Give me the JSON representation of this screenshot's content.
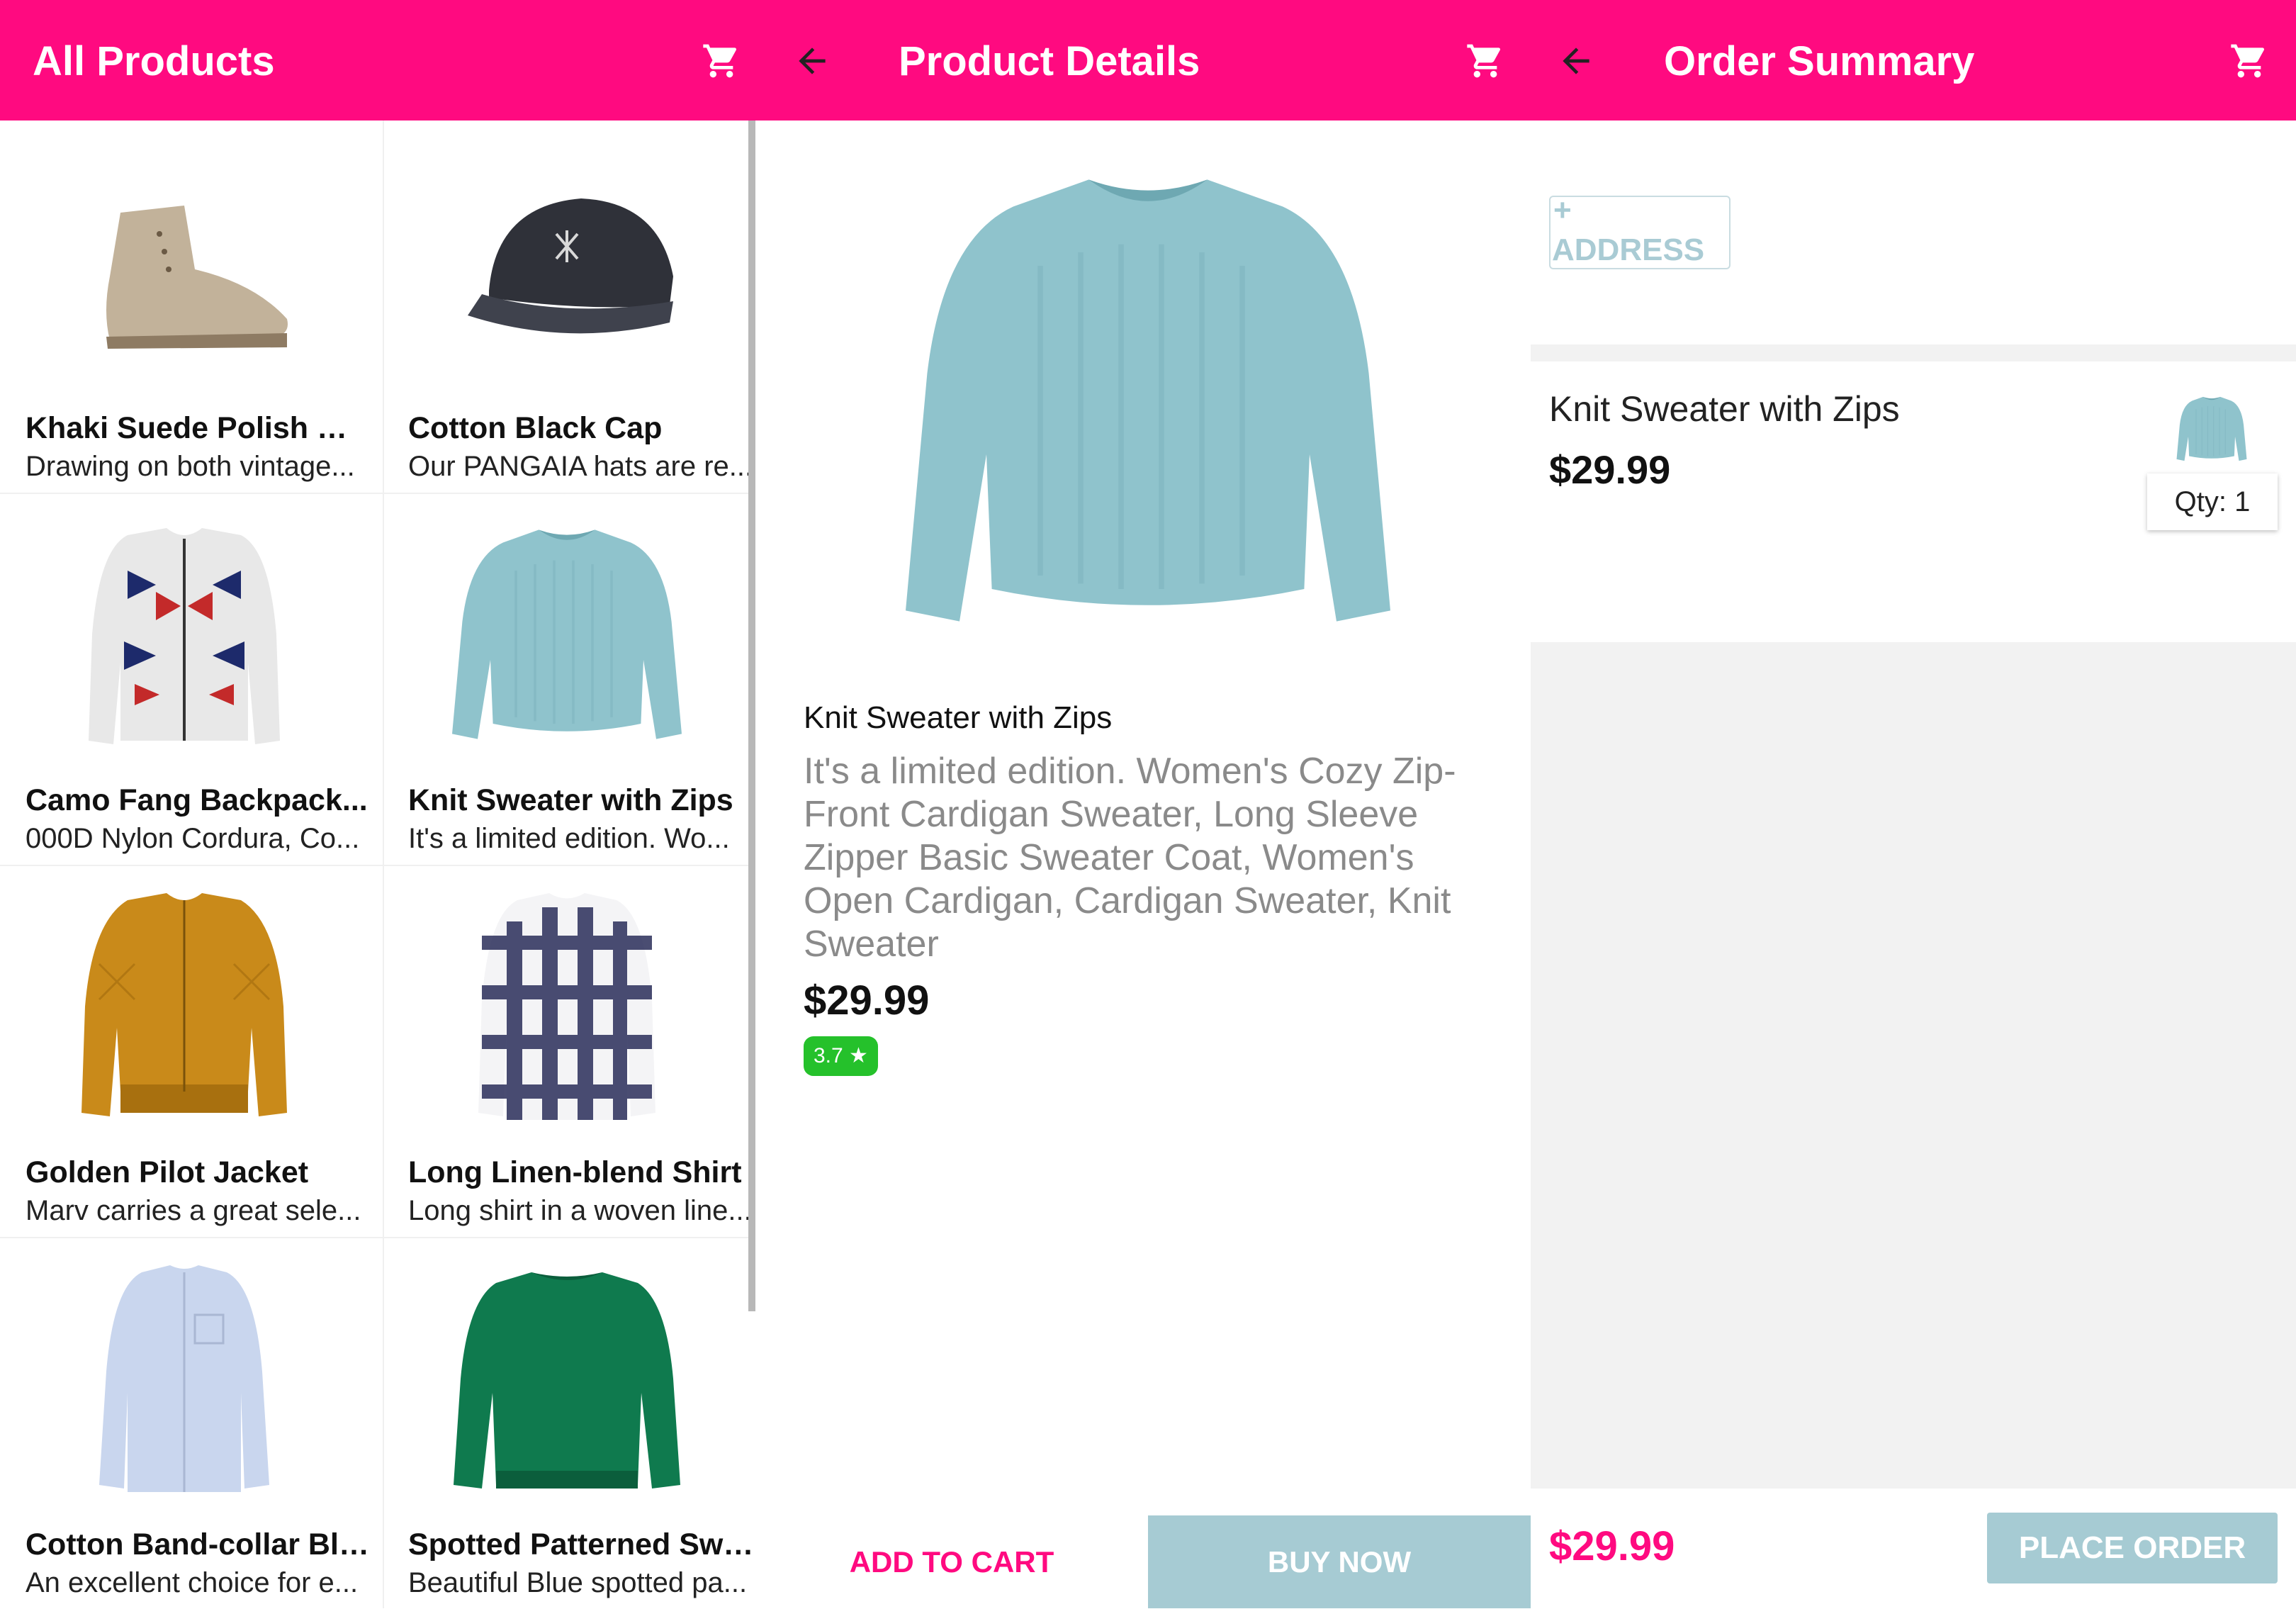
{
  "theme": {
    "primary": "#ff0a80",
    "muted_button": "#a6cbd3",
    "rating_green": "#25c12b"
  },
  "products_screen": {
    "title": "All Products",
    "cart_icon": "cart-icon",
    "products": [
      {
        "name": "Khaki Suede Polish Wo...",
        "description": "Drawing on both vintage..."
      },
      {
        "name": "Cotton Black Cap",
        "description": "Our PANGAIA hats are re..."
      },
      {
        "name": "Camo Fang Backpack...",
        "description": "000D Nylon Cordura, Co..."
      },
      {
        "name": "Knit Sweater with Zips",
        "description": "It's a limited edition. Wo..."
      },
      {
        "name": "Golden Pilot Jacket",
        "description": "Marv carries a great sele..."
      },
      {
        "name": "Long Linen-blend Shirt",
        "description": "Long shirt in a woven line..."
      },
      {
        "name": "Cotton Band-collar Blo...",
        "description": "An excellent choice for e..."
      },
      {
        "name": "Spotted Patterned Swe...",
        "description": "Beautiful Blue spotted pa..."
      }
    ]
  },
  "details_screen": {
    "title": "Product Details",
    "back_icon": "arrow-left-icon",
    "cart_icon": "cart-icon",
    "product_name": "Knit Sweater with Zips",
    "description": "It's a limited edition. Women's Cozy Zip-Front Cardigan Sweater, Long Sleeve Zipper Basic Sweater Coat, Women's Open Cardigan, Cardigan Sweater, Knit Sweater",
    "price": "$29.99",
    "rating": "3.7 ★",
    "add_to_cart": "ADD TO CART",
    "buy_now": "BUY NOW"
  },
  "summary_screen": {
    "title": "Order Summary",
    "back_icon": "arrow-left-icon",
    "cart_icon": "cart-icon",
    "add_address_plus": "+",
    "add_address_label": "ADDRESS",
    "item_name": "Knit Sweater with Zips",
    "item_price": "$29.99",
    "quantity": "Qty: 1",
    "total": "$29.99",
    "place_order": "PLACE ORDER"
  }
}
